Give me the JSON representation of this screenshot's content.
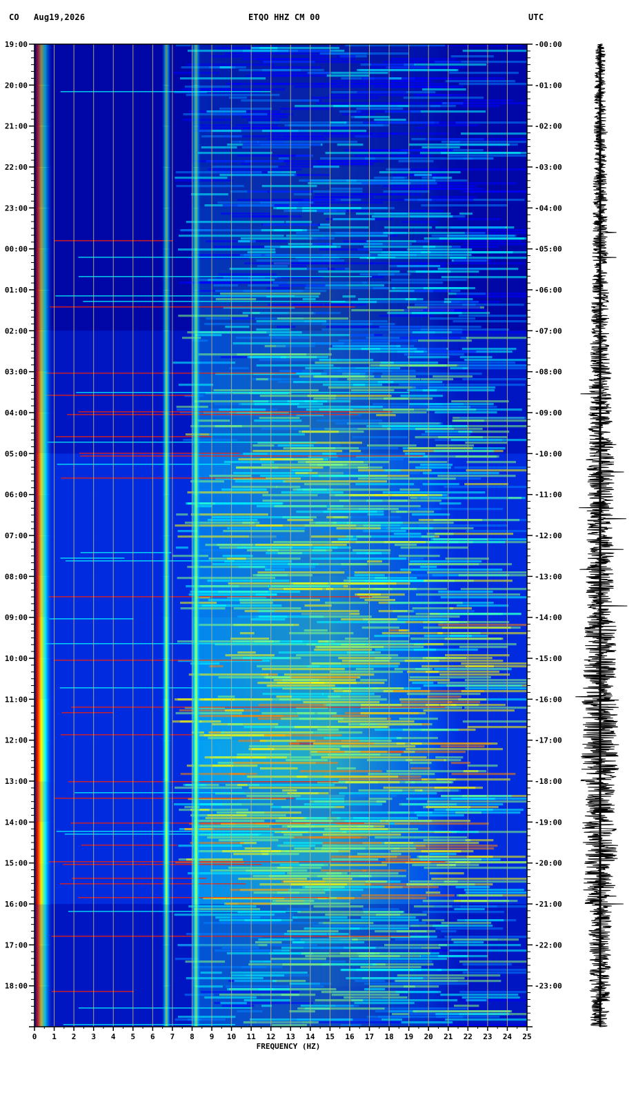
{
  "header": {
    "network": "CO",
    "date": "Aug19,2026",
    "station": "ETQO HHZ CM 00",
    "timezone": "UTC"
  },
  "chart_data": {
    "type": "heatmap",
    "subtype": "spectrogram",
    "xlabel": "FREQUENCY (HZ)",
    "x_ticks": [
      "0",
      "1",
      "2",
      "3",
      "4",
      "5",
      "6",
      "7",
      "8",
      "9",
      "10",
      "11",
      "12",
      "13",
      "14",
      "15",
      "16",
      "17",
      "18",
      "19",
      "20",
      "21",
      "22",
      "23",
      "24",
      "25"
    ],
    "xlim": [
      0,
      25
    ],
    "y_left_ticks": [
      "19:00",
      "20:00",
      "21:00",
      "22:00",
      "23:00",
      "00:00",
      "01:00",
      "02:00",
      "03:00",
      "04:00",
      "05:00",
      "06:00",
      "07:00",
      "08:00",
      "09:00",
      "10:00",
      "11:00",
      "12:00",
      "13:00",
      "14:00",
      "15:00",
      "16:00",
      "17:00",
      "18:00"
    ],
    "y_right_ticks": [
      "00:00",
      "01:00",
      "02:00",
      "03:00",
      "04:00",
      "05:00",
      "06:00",
      "07:00",
      "08:00",
      "09:00",
      "10:00",
      "11:00",
      "12:00",
      "13:00",
      "14:00",
      "15:00",
      "16:00",
      "17:00",
      "18:00",
      "19:00",
      "20:00",
      "21:00",
      "22:00",
      "23:00"
    ],
    "hours_shown": 24,
    "grid": true,
    "colormap": [
      "#00008f",
      "#0000ff",
      "#0080ff",
      "#00ffff",
      "#80ff80",
      "#ffff00",
      "#ff8000",
      "#ff0000",
      "#800000"
    ],
    "background_color": "#00008f",
    "dominant_bands_hz": [
      0.2,
      6.7,
      8.2
    ],
    "activity_profile": [
      0.15,
      0.18,
      0.2,
      0.25,
      0.28,
      0.3,
      0.35,
      0.4,
      0.5,
      0.55,
      0.65,
      0.6,
      0.6,
      0.65,
      0.75,
      0.8,
      0.9,
      0.95,
      0.7,
      0.85,
      0.8,
      0.5,
      0.45,
      0.4
    ],
    "waveform_color": "#000000"
  }
}
